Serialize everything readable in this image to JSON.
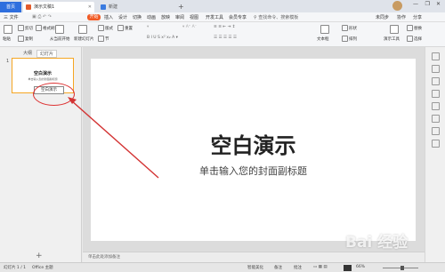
{
  "tabs": {
    "home": "首页",
    "doc": "演示文稿1",
    "new": "新建",
    "plus": "+"
  },
  "menu": {
    "file": "三 文件",
    "start": "开始",
    "items": [
      "插入",
      "设计",
      "切换",
      "动画",
      "放映",
      "审阅",
      "视图",
      "开发工具",
      "会员专享"
    ],
    "search": "查找命令、搜索模板",
    "right": [
      "未同步",
      "协作",
      "分享"
    ]
  },
  "toolbar": {
    "paste": "粘贴",
    "cut": "剪切",
    "copy": "复制",
    "format": "格式刷",
    "from_current": "从当前开始",
    "new_slide": "新建幻灯片",
    "layout": "版式",
    "section": "节",
    "reset": "重置",
    "textbox": "文本框",
    "shape": "形状",
    "arrange": "排列",
    "tools": "演示工具",
    "replace": "替换",
    "select": "选择"
  },
  "leftpanel": {
    "tab_outline": "大纲",
    "tab_slides": "幻灯片",
    "slide_no": "1",
    "add": "+"
  },
  "thumb": {
    "title": "空白演示",
    "sub": "单击输入您的封面副标题"
  },
  "tooltip": "空白演示",
  "slide": {
    "title": "空白演示",
    "subtitle": "单击输入您的封面副标题"
  },
  "notes": "单击此处添加备注",
  "status": {
    "slide": "幻灯片 1 / 1",
    "theme": "Office 主题",
    "smart": "智能美化",
    "notes": "备注",
    "comment": "批注",
    "zoom": "66%"
  },
  "watermark": "Bai 经验",
  "colors": {
    "accent": "#2f6fde",
    "start": "#f15a24",
    "annotation": "#d33333"
  }
}
